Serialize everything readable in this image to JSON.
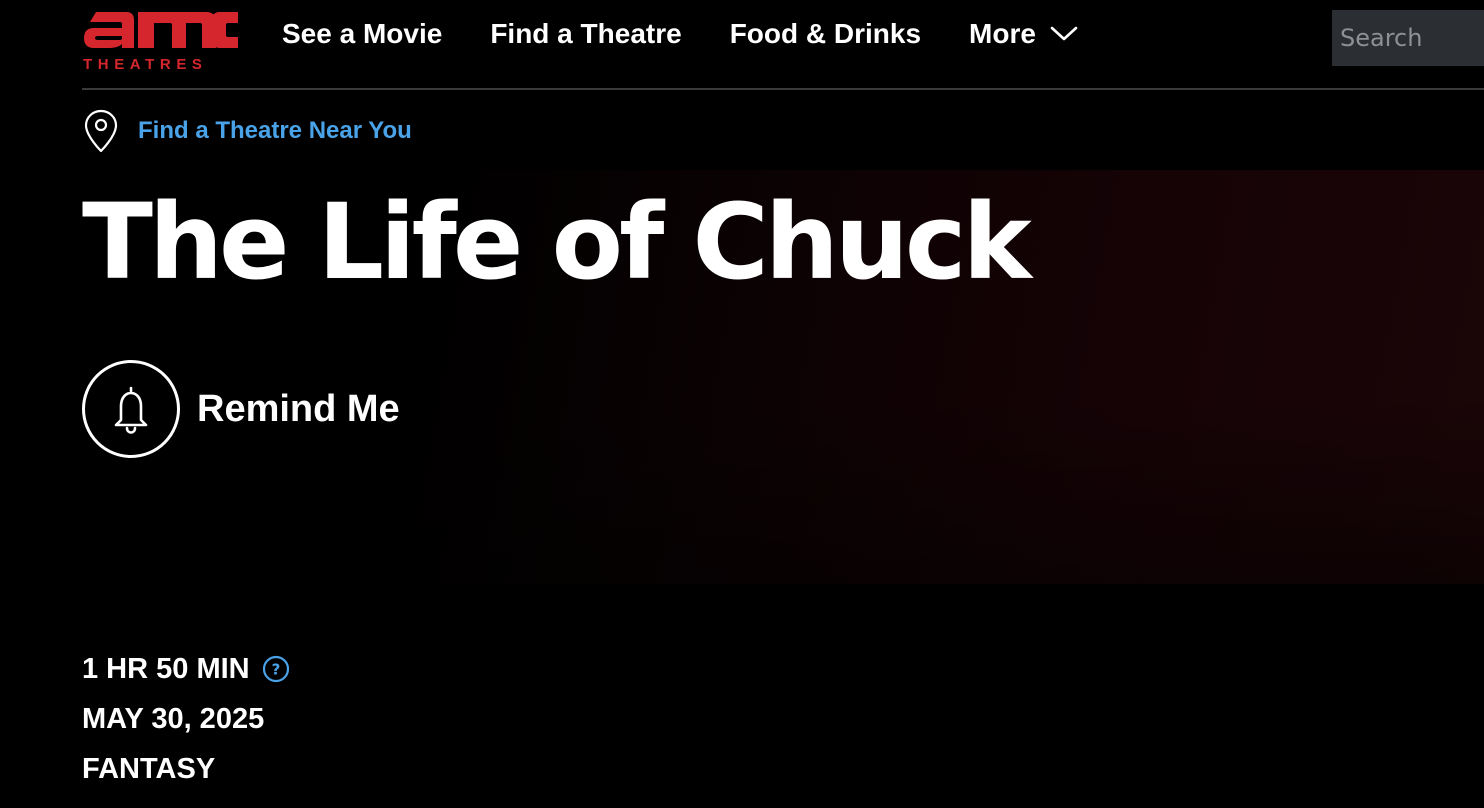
{
  "brand": {
    "name": "AMC Theatres",
    "logo_word": "amc",
    "logo_sub": "THEATRES",
    "color": "#d5262e"
  },
  "nav": {
    "items": [
      {
        "label": "See a Movie"
      },
      {
        "label": "Find a Theatre"
      },
      {
        "label": "Food & Drinks"
      },
      {
        "label": "More",
        "icon": "chevron-down-icon"
      }
    ]
  },
  "search": {
    "placeholder": "Search",
    "value": ""
  },
  "location": {
    "icon": "map-pin-icon",
    "label": "Find a Theatre Near You",
    "color": "#4aa3e8"
  },
  "movie": {
    "title": "The Life of Chuck",
    "remind_label": "Remind Me",
    "remind_icon": "bell-icon",
    "runtime": "1 HR 50 MIN",
    "runtime_help_icon": "question-circle-icon",
    "release_date": "MAY 30, 2025",
    "genre": "FANTASY"
  },
  "colors": {
    "background": "#000000",
    "text": "#ffffff",
    "accent_blue": "#4aa3e8",
    "search_bg": "#2b2f33"
  }
}
